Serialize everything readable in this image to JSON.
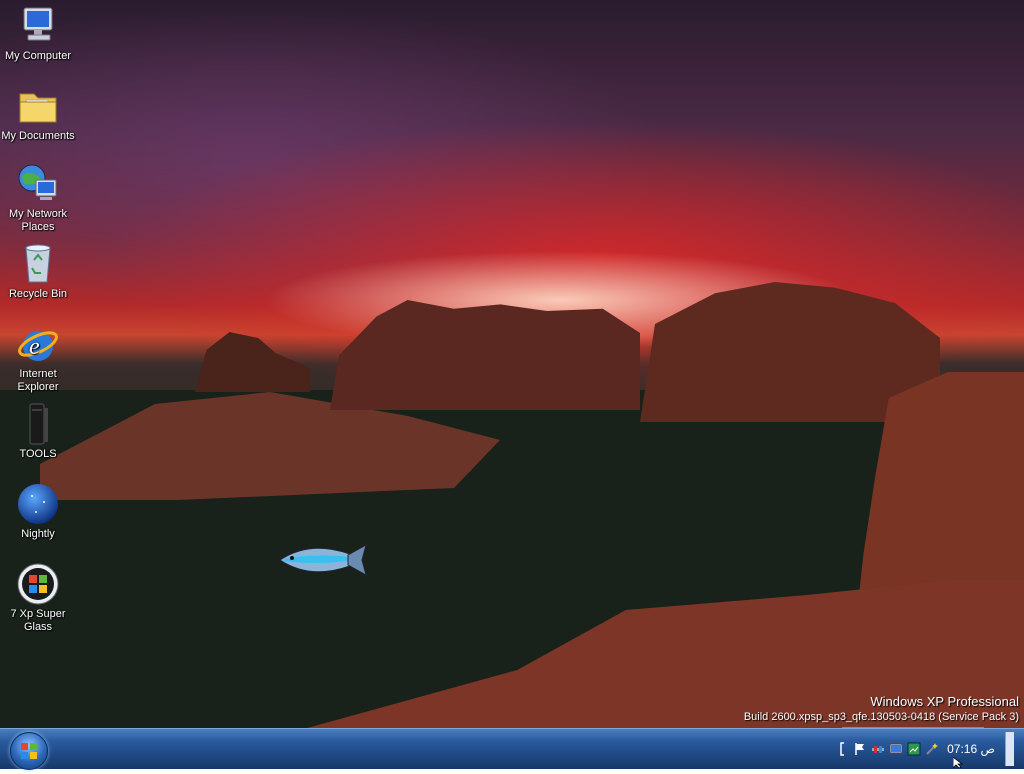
{
  "desktop": {
    "icons": [
      {
        "id": "my-computer",
        "label": "My Computer",
        "icon": "computer-icon"
      },
      {
        "id": "my-documents",
        "label": "My Documents",
        "icon": "folder-icon"
      },
      {
        "id": "my-network-places",
        "label": "My Network Places",
        "icon": "network-icon"
      },
      {
        "id": "recycle-bin",
        "label": "Recycle Bin",
        "icon": "recycle-bin-icon"
      },
      {
        "id": "internet-explorer",
        "label": "Internet Explorer",
        "icon": "ie-icon"
      },
      {
        "id": "tools",
        "label": "TOOLS",
        "icon": "tools-icon"
      },
      {
        "id": "nightly",
        "label": "Nightly",
        "icon": "nightly-icon"
      },
      {
        "id": "7-xp-super-glass",
        "label": "7 Xp Super Glass",
        "icon": "windows-orb-icon"
      }
    ],
    "brand": {
      "name": "Windows XP Professional",
      "build": "Build 2600.xpsp_sp3_qfe.130503-0418 (Service Pack 3)"
    }
  },
  "taskbar": {
    "start_icon": "windows-orb-icon",
    "tray_icons": [
      "bracket-icon",
      "flag-icon",
      "network-icon",
      "monitor-icon",
      "update-icon",
      "wand-icon"
    ],
    "clock": "07:16 ص"
  },
  "colors": {
    "taskbar_top": "#4a7ec0",
    "taskbar_bottom": "#16386a",
    "desktop_text": "#ffffff"
  }
}
